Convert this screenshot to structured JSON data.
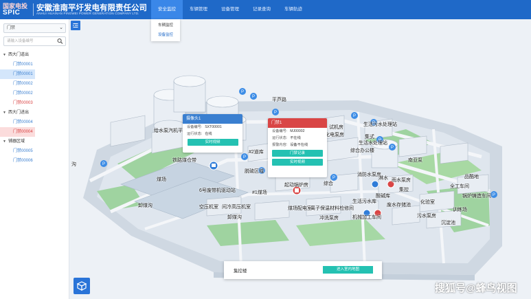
{
  "header": {
    "logo_cn": "国家电投",
    "logo_en": "SPIC",
    "company_cn": "安徽淮南平圩发电有限责任公司",
    "company_en": "ANHUI HUAINAN PINGWEI POWER GENERATION COMPANY LTD.",
    "nav": [
      "安全监控",
      "车辆管理",
      "设备管理",
      "记录查询",
      "车辆轨迹"
    ],
    "active_nav": 0,
    "dropdown": [
      "车辆监控",
      "设备监控"
    ]
  },
  "sidebar": {
    "select_value": "门禁",
    "search_placeholder": "请输入设备编号",
    "groups": [
      {
        "label": "西大门道出",
        "items": [
          {
            "label": "门禁00001",
            "state": "normal"
          },
          {
            "label": "门禁00001",
            "state": "selected"
          },
          {
            "label": "门禁00002",
            "state": "normal"
          },
          {
            "label": "门禁00002",
            "state": "normal"
          },
          {
            "label": "门禁00003",
            "state": "alarm"
          }
        ]
      },
      {
        "label": "西大门进出",
        "items": [
          {
            "label": "门禁00004",
            "state": "normal"
          },
          {
            "label": "门禁00004",
            "state": "alarm-selected"
          }
        ]
      },
      {
        "label": "铺器区域",
        "items": [
          {
            "label": "门禁00005",
            "state": "normal"
          },
          {
            "label": "门禁00006",
            "state": "normal"
          }
        ]
      }
    ]
  },
  "popup_camera": {
    "title": "摄像头1",
    "rows": [
      [
        "设备编号:",
        "SXT00001"
      ],
      [
        "运行状态:",
        "在线"
      ]
    ],
    "button": "实时视频",
    "color": "#3a7fd0"
  },
  "popup_gate": {
    "title": "门禁1",
    "rows": [
      [
        "设备编号:",
        "MJ00002"
      ],
      [
        "运行状态:",
        "不在线"
      ],
      [
        "报警内容:",
        "设备不在线"
      ]
    ],
    "buttons": [
      "门禁记录",
      "实时视频"
    ],
    "color": "#d94545"
  },
  "bottom_panel": {
    "title": "集控楼",
    "button": "进入室内地图"
  },
  "map_labels": {
    "row1": [
      "平芦路",
      "试机房",
      "化电泵房",
      "生活污水处理站",
      "集式",
      "综合办公楼"
    ],
    "row2": [
      "给水泵汽机平台",
      "煤场",
      "6号废带机驱动站",
      "#1煤场",
      "起动锅炉房",
      "消防水泵房",
      "雨水泵房",
      "酸碱库",
      "生活水处理站"
    ],
    "row3": [
      "卸煤沟",
      "空压机室",
      "间冷高压机室",
      "煤场配电室",
      "离子保温材料检修间",
      "生活污水库",
      "废水存储池",
      "化验室",
      "污水泵房",
      "沉淀池"
    ],
    "row4": [
      "铁路煤仓带",
      "#2道库",
      "脱硫区域",
      "综合",
      "淋水",
      "集控",
      "南亚泵",
      "品酷地",
      "全工车间",
      "锅炉铸造车间",
      "训练场"
    ],
    "row5": [
      "卸煤沟",
      "沟",
      "机械加工车间",
      "冲洗泵房"
    ]
  },
  "watermark": "搜狐号@蜂鸟视图"
}
